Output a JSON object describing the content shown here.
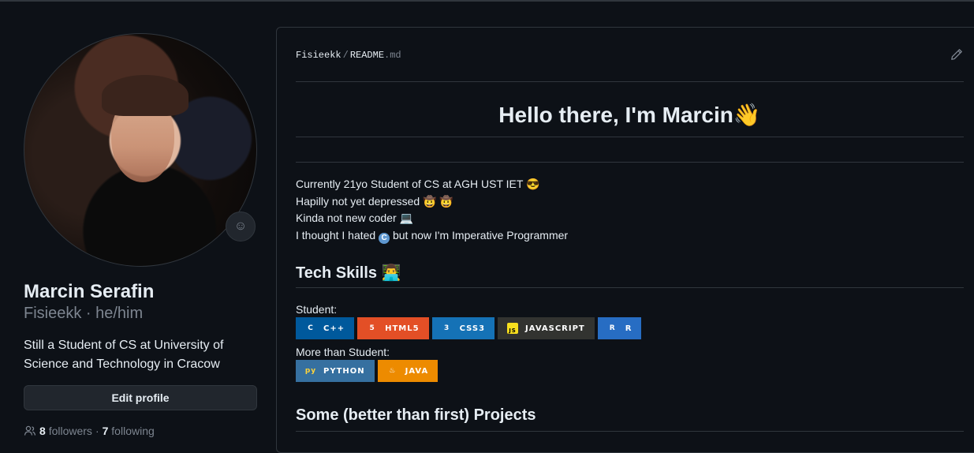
{
  "profile": {
    "name": "Marcin Serafin",
    "subline": "Fisieekk · he/him",
    "bio": "Still a Student of CS at University of Science and Technology in Cracow",
    "edit_label": "Edit profile",
    "followers_count": "8",
    "followers_label": "followers",
    "separator": "·",
    "following_count": "7",
    "following_label": "following"
  },
  "readme": {
    "path_user": "Fisieekk",
    "path_sep": "/",
    "path_file": "README",
    "path_ext": ".md",
    "heading": "Hello there, I'm Marcin👋",
    "intro": [
      "Currently 21yo Student of CS at AGH UST IET 😎",
      "Hapilly not yet depressed 🤠 🤠",
      "Kinda not new coder 💻"
    ],
    "intro_last_before": "I thought I hated ",
    "intro_last_after": " but now I'm Imperative Programmer",
    "tech_heading": "Tech Skills 👨‍💻",
    "student_label": "Student:",
    "more_label": "More than Student:",
    "projects_heading": "Some (better than first) Projects"
  },
  "badges_student": [
    {
      "label": "C++",
      "color": "#00599c",
      "icon": "C"
    },
    {
      "label": "HTML5",
      "color": "#e34f26",
      "icon": "5"
    },
    {
      "label": "CSS3",
      "color": "#1572b6",
      "icon": "3"
    },
    {
      "label": "JAVASCRIPT",
      "color": "#323330",
      "icon": "JS"
    },
    {
      "label": "R",
      "color": "#276dc3",
      "icon": "R"
    }
  ],
  "badges_more": [
    {
      "label": "PYTHON",
      "color": "#3670a0",
      "icon": "py"
    },
    {
      "label": "JAVA",
      "color": "#ed8b00",
      "icon": "♨"
    }
  ]
}
